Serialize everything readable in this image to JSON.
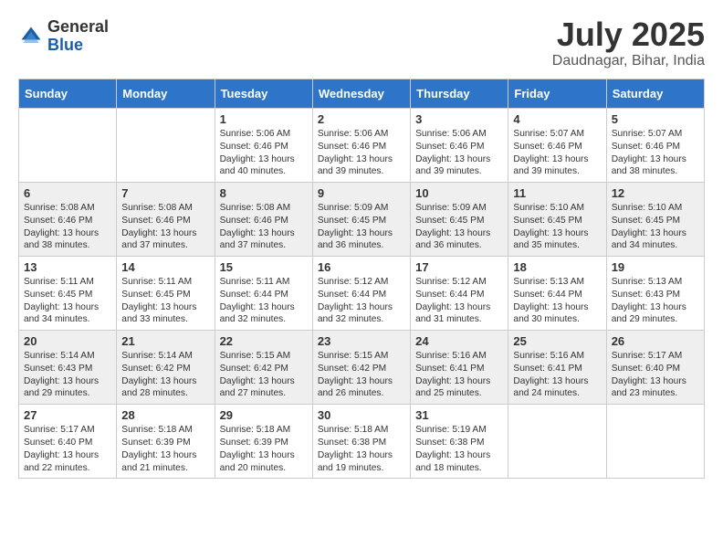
{
  "logo": {
    "general": "General",
    "blue": "Blue"
  },
  "title": {
    "month_year": "July 2025",
    "location": "Daudnagar, Bihar, India"
  },
  "days_of_week": [
    "Sunday",
    "Monday",
    "Tuesday",
    "Wednesday",
    "Thursday",
    "Friday",
    "Saturday"
  ],
  "weeks": [
    [
      {
        "day": "",
        "content": ""
      },
      {
        "day": "",
        "content": ""
      },
      {
        "day": "1",
        "content": "Sunrise: 5:06 AM\nSunset: 6:46 PM\nDaylight: 13 hours and 40 minutes."
      },
      {
        "day": "2",
        "content": "Sunrise: 5:06 AM\nSunset: 6:46 PM\nDaylight: 13 hours and 39 minutes."
      },
      {
        "day": "3",
        "content": "Sunrise: 5:06 AM\nSunset: 6:46 PM\nDaylight: 13 hours and 39 minutes."
      },
      {
        "day": "4",
        "content": "Sunrise: 5:07 AM\nSunset: 6:46 PM\nDaylight: 13 hours and 39 minutes."
      },
      {
        "day": "5",
        "content": "Sunrise: 5:07 AM\nSunset: 6:46 PM\nDaylight: 13 hours and 38 minutes."
      }
    ],
    [
      {
        "day": "6",
        "content": "Sunrise: 5:08 AM\nSunset: 6:46 PM\nDaylight: 13 hours and 38 minutes."
      },
      {
        "day": "7",
        "content": "Sunrise: 5:08 AM\nSunset: 6:46 PM\nDaylight: 13 hours and 37 minutes."
      },
      {
        "day": "8",
        "content": "Sunrise: 5:08 AM\nSunset: 6:46 PM\nDaylight: 13 hours and 37 minutes."
      },
      {
        "day": "9",
        "content": "Sunrise: 5:09 AM\nSunset: 6:45 PM\nDaylight: 13 hours and 36 minutes."
      },
      {
        "day": "10",
        "content": "Sunrise: 5:09 AM\nSunset: 6:45 PM\nDaylight: 13 hours and 36 minutes."
      },
      {
        "day": "11",
        "content": "Sunrise: 5:10 AM\nSunset: 6:45 PM\nDaylight: 13 hours and 35 minutes."
      },
      {
        "day": "12",
        "content": "Sunrise: 5:10 AM\nSunset: 6:45 PM\nDaylight: 13 hours and 34 minutes."
      }
    ],
    [
      {
        "day": "13",
        "content": "Sunrise: 5:11 AM\nSunset: 6:45 PM\nDaylight: 13 hours and 34 minutes."
      },
      {
        "day": "14",
        "content": "Sunrise: 5:11 AM\nSunset: 6:45 PM\nDaylight: 13 hours and 33 minutes."
      },
      {
        "day": "15",
        "content": "Sunrise: 5:11 AM\nSunset: 6:44 PM\nDaylight: 13 hours and 32 minutes."
      },
      {
        "day": "16",
        "content": "Sunrise: 5:12 AM\nSunset: 6:44 PM\nDaylight: 13 hours and 32 minutes."
      },
      {
        "day": "17",
        "content": "Sunrise: 5:12 AM\nSunset: 6:44 PM\nDaylight: 13 hours and 31 minutes."
      },
      {
        "day": "18",
        "content": "Sunrise: 5:13 AM\nSunset: 6:44 PM\nDaylight: 13 hours and 30 minutes."
      },
      {
        "day": "19",
        "content": "Sunrise: 5:13 AM\nSunset: 6:43 PM\nDaylight: 13 hours and 29 minutes."
      }
    ],
    [
      {
        "day": "20",
        "content": "Sunrise: 5:14 AM\nSunset: 6:43 PM\nDaylight: 13 hours and 29 minutes."
      },
      {
        "day": "21",
        "content": "Sunrise: 5:14 AM\nSunset: 6:42 PM\nDaylight: 13 hours and 28 minutes."
      },
      {
        "day": "22",
        "content": "Sunrise: 5:15 AM\nSunset: 6:42 PM\nDaylight: 13 hours and 27 minutes."
      },
      {
        "day": "23",
        "content": "Sunrise: 5:15 AM\nSunset: 6:42 PM\nDaylight: 13 hours and 26 minutes."
      },
      {
        "day": "24",
        "content": "Sunrise: 5:16 AM\nSunset: 6:41 PM\nDaylight: 13 hours and 25 minutes."
      },
      {
        "day": "25",
        "content": "Sunrise: 5:16 AM\nSunset: 6:41 PM\nDaylight: 13 hours and 24 minutes."
      },
      {
        "day": "26",
        "content": "Sunrise: 5:17 AM\nSunset: 6:40 PM\nDaylight: 13 hours and 23 minutes."
      }
    ],
    [
      {
        "day": "27",
        "content": "Sunrise: 5:17 AM\nSunset: 6:40 PM\nDaylight: 13 hours and 22 minutes."
      },
      {
        "day": "28",
        "content": "Sunrise: 5:18 AM\nSunset: 6:39 PM\nDaylight: 13 hours and 21 minutes."
      },
      {
        "day": "29",
        "content": "Sunrise: 5:18 AM\nSunset: 6:39 PM\nDaylight: 13 hours and 20 minutes."
      },
      {
        "day": "30",
        "content": "Sunrise: 5:18 AM\nSunset: 6:38 PM\nDaylight: 13 hours and 19 minutes."
      },
      {
        "day": "31",
        "content": "Sunrise: 5:19 AM\nSunset: 6:38 PM\nDaylight: 13 hours and 18 minutes."
      },
      {
        "day": "",
        "content": ""
      },
      {
        "day": "",
        "content": ""
      }
    ]
  ]
}
